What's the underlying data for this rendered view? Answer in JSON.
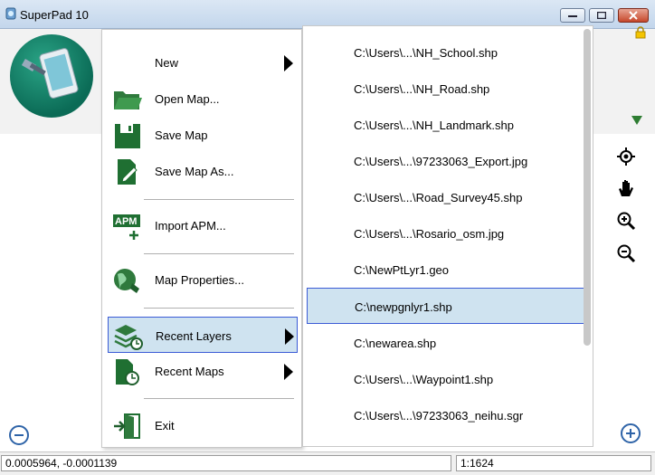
{
  "window": {
    "title": "SuperPad 10",
    "icon": "superpad-app-icon"
  },
  "menu": {
    "items": [
      {
        "label": "New",
        "icon": "blank-icon",
        "has_submenu": true
      },
      {
        "label": "Open Map...",
        "icon": "folder-open-icon",
        "has_submenu": false
      },
      {
        "label": "Save Map",
        "icon": "save-icon",
        "has_submenu": false
      },
      {
        "label": "Save Map As...",
        "icon": "save-as-icon",
        "has_submenu": false
      },
      {
        "label": "Import APM...",
        "icon": "apm-import-icon",
        "has_submenu": false
      },
      {
        "label": "Map Properties...",
        "icon": "globe-icon",
        "has_submenu": false
      },
      {
        "label": "Recent Layers",
        "icon": "layers-clock-icon",
        "has_submenu": true,
        "selected": true
      },
      {
        "label": "Recent Maps",
        "icon": "map-clock-icon",
        "has_submenu": true
      },
      {
        "label": "Exit",
        "icon": "exit-door-icon",
        "has_submenu": false
      }
    ]
  },
  "recent_layers": [
    "C:\\Users\\...\\NH_School.shp",
    "C:\\Users\\...\\NH_Road.shp",
    "C:\\Users\\...\\NH_Landmark.shp",
    "C:\\Users\\...\\97233063_Export.jpg",
    "C:\\Users\\...\\Road_Survey45.shp",
    "C:\\Users\\...\\Rosario_osm.jpg",
    "C:\\NewPtLyr1.geo",
    "C:\\newpgnlyr1.shp",
    "C:\\newarea.shp",
    "C:\\Users\\...\\Waypoint1.shp",
    "C:\\Users\\...\\97233063_neihu.sgr"
  ],
  "selected_recent_layer_index": 7,
  "toolbar": {
    "tools": [
      "locate-icon",
      "pan-hand-icon",
      "zoom-in-icon",
      "zoom-out-icon"
    ]
  },
  "status": {
    "coordinates": "0.0005964, -0.0001139",
    "scale": "1:1624"
  },
  "colors": {
    "selection_fill": "#cfe3f0",
    "selection_border": "#3b5bd6",
    "accent_green": "#2e7d32"
  }
}
